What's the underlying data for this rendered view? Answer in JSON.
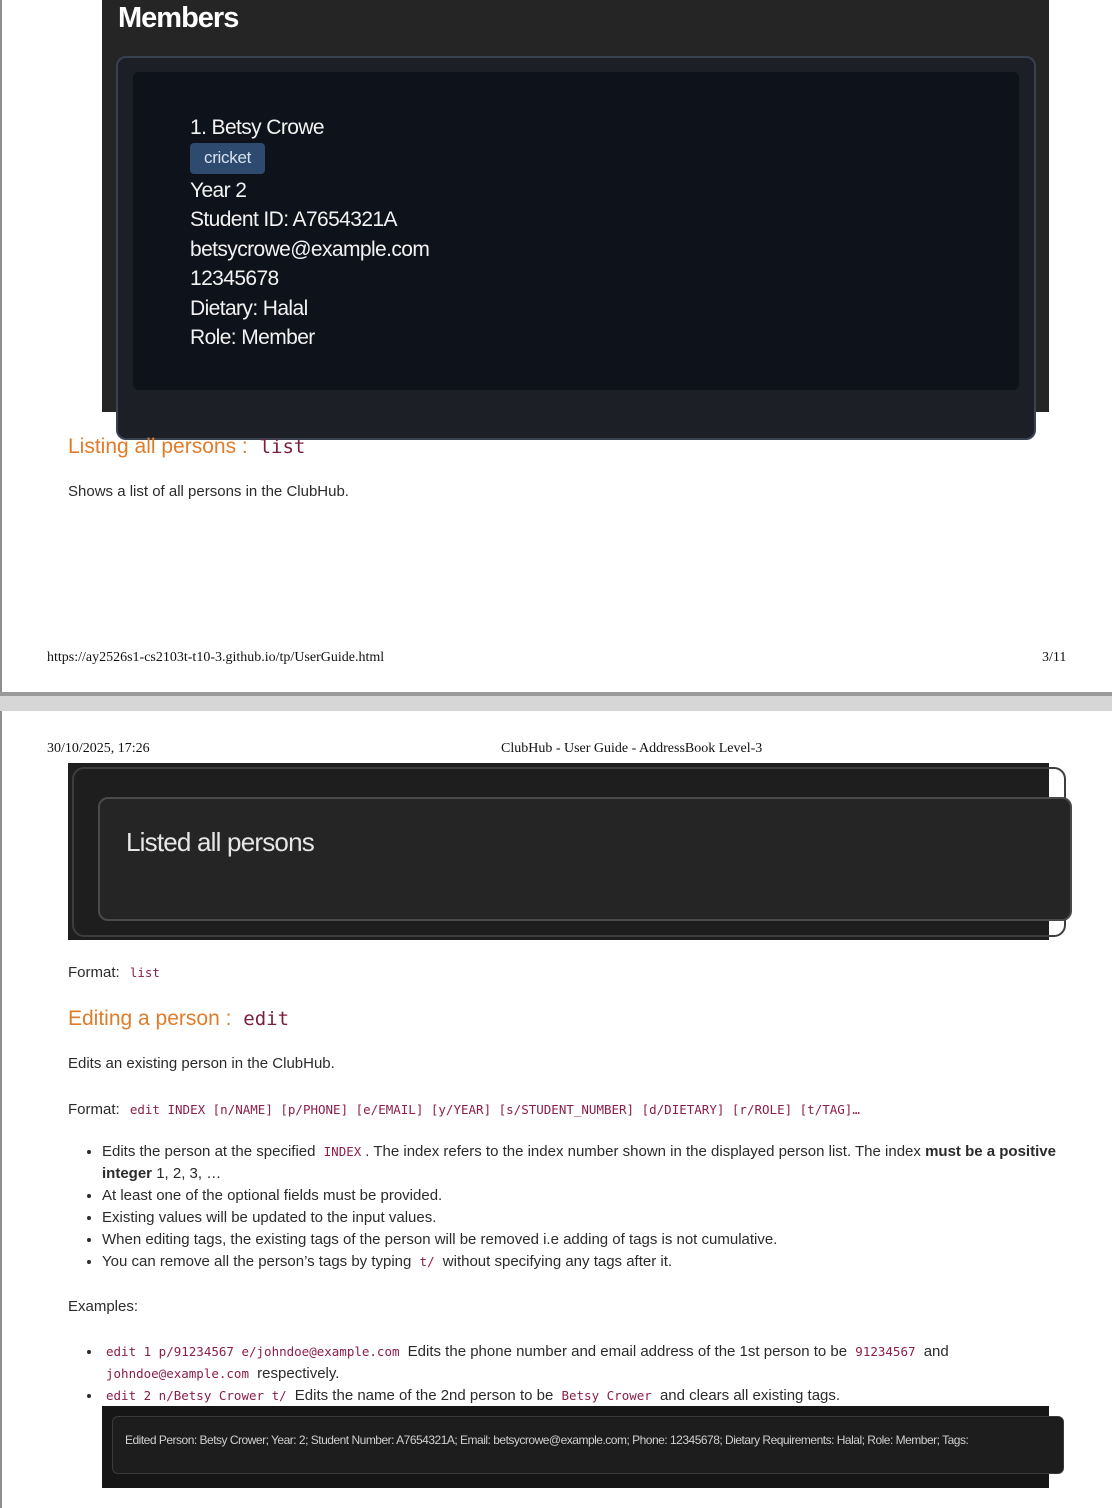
{
  "page1": {
    "screenshot": {
      "title": "Members",
      "card": {
        "name_line": "1. Betsy Crowe",
        "tag": "cricket",
        "year": "Year 2",
        "student_id": "Student ID: A7654321A",
        "email": "betsycrowe@example.com",
        "phone": "12345678",
        "dietary": "Dietary: Halal",
        "role": "Role: Member"
      }
    },
    "list_section": {
      "heading": "Listing all persons :",
      "command": "list",
      "description": "Shows a list of all persons in the ClubHub."
    },
    "footer": {
      "url": "https://ay2526s1-cs2103t-t10-3.github.io/tp/UserGuide.html",
      "page_number": "3/11"
    }
  },
  "page2": {
    "header": {
      "datetime": "30/10/2025, 17:26",
      "doc_title": "ClubHub - User Guide - AddressBook Level-3"
    },
    "result_box": {
      "text": "Listed all persons"
    },
    "list_format": {
      "label": "Format:",
      "command": "list"
    },
    "edit_section": {
      "heading": "Editing a person :",
      "command": "edit",
      "description": "Edits an existing person in the ClubHub.",
      "format_label": "Format:",
      "format_command": "edit INDEX [n/NAME] [p/PHONE] [e/EMAIL] [y/YEAR] [s/STUDENT_NUMBER] [d/DIETARY] [r/ROLE] [t/TAG]…",
      "bullets": {
        "b1_pre": "Edits the person at the specified",
        "b1_code": "INDEX",
        "b1_post": ". The index refers to the index number shown in the displayed person list. The index",
        "b1_bold": "must be a positive integer",
        "b1_tail": "1, 2, 3, …",
        "b2": "At least one of the optional fields must be provided.",
        "b3": "Existing values will be updated to the input values.",
        "b4": "When editing tags, the existing tags of the person will be removed i.e adding of tags is not cumulative.",
        "b5_pre": "You can remove all the person’s tags by typing",
        "b5_code": "t/",
        "b5_post": "without specifying any tags after it."
      },
      "examples_label": "Examples:",
      "examples": {
        "e1_code": "edit 1 p/91234567 e/johndoe@example.com",
        "e1_text": "Edits the phone number and email address of the 1st person to be",
        "e1_code2": "91234567",
        "e1_and": "and",
        "e1_code3": "johndoe@example.com",
        "e1_tail": "respectively.",
        "e2_code": "edit 2 n/Betsy Crower t/",
        "e2_text": "Edits the name of the 2nd person to be",
        "e2_code2": "Betsy Crower",
        "e2_tail": "and clears all existing tags."
      },
      "edited_result": "Edited Person: Betsy Crower; Year: 2; Student Number: A7654321A; Email: betsycrowe@example.com; Phone: 12345678; Dietary Requirements: Halal; Role: Member; Tags:"
    }
  }
}
